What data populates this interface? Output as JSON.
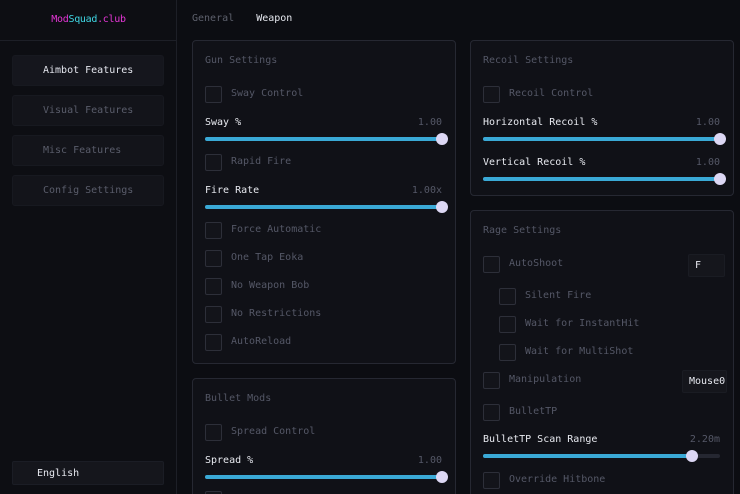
{
  "app": {
    "logo": [
      "Mod",
      "Squad",
      ".club"
    ]
  },
  "sidebar": {
    "items": [
      {
        "label": "Aimbot Features"
      },
      {
        "label": "Visual Features"
      },
      {
        "label": "Misc Features"
      },
      {
        "label": "Config Settings"
      }
    ],
    "language": "English"
  },
  "tabs": [
    "General",
    "Weapon"
  ],
  "colors": {
    "accent": "#3aa9d6",
    "thumb": "#dcd7f4",
    "logo_pink": "#e535d6",
    "logo_cyan": "#3fd7e4"
  },
  "gun": {
    "title": "Gun Settings",
    "sway_control": "Sway Control",
    "sway": {
      "label": "Sway %",
      "value": "1.00",
      "fraction": 1.0
    },
    "rapid_fire": "Rapid Fire",
    "fire_rate": {
      "label": "Fire Rate",
      "value": "1.00x",
      "fraction": 1.0
    },
    "force_automatic": "Force Automatic",
    "one_tap_eoka": "One Tap Eoka",
    "no_weapon_bob": "No Weapon Bob",
    "no_restrictions": "No Restrictions",
    "auto_reload": "AutoReload"
  },
  "bullet": {
    "title": "Bullet Mods",
    "spread_control": "Spread Control",
    "spread": {
      "label": "Spread %",
      "value": "1.00",
      "fraction": 1.0
    }
  },
  "recoil": {
    "title": "Recoil Settings",
    "recoil_control": "Recoil Control",
    "horizontal": {
      "label": "Horizontal Recoil %",
      "value": "1.00",
      "fraction": 1.0
    },
    "vertical": {
      "label": "Vertical Recoil %",
      "value": "1.00",
      "fraction": 1.0
    }
  },
  "rage": {
    "title": "Rage Settings",
    "autoshoot": "AutoShoot",
    "autoshoot_key": "F",
    "silent_fire": "Silent Fire",
    "wait_instanthit": "Wait for InstantHit",
    "wait_multishot": "Wait for MultiShot",
    "manipulation": "Manipulation",
    "manipulation_key": "Mouse0",
    "bullettp": "BulletTP",
    "scan_range": {
      "label": "BulletTP Scan Range",
      "value": "2.20m",
      "fraction": 0.88
    },
    "override_hitbone": "Override Hitbone"
  }
}
